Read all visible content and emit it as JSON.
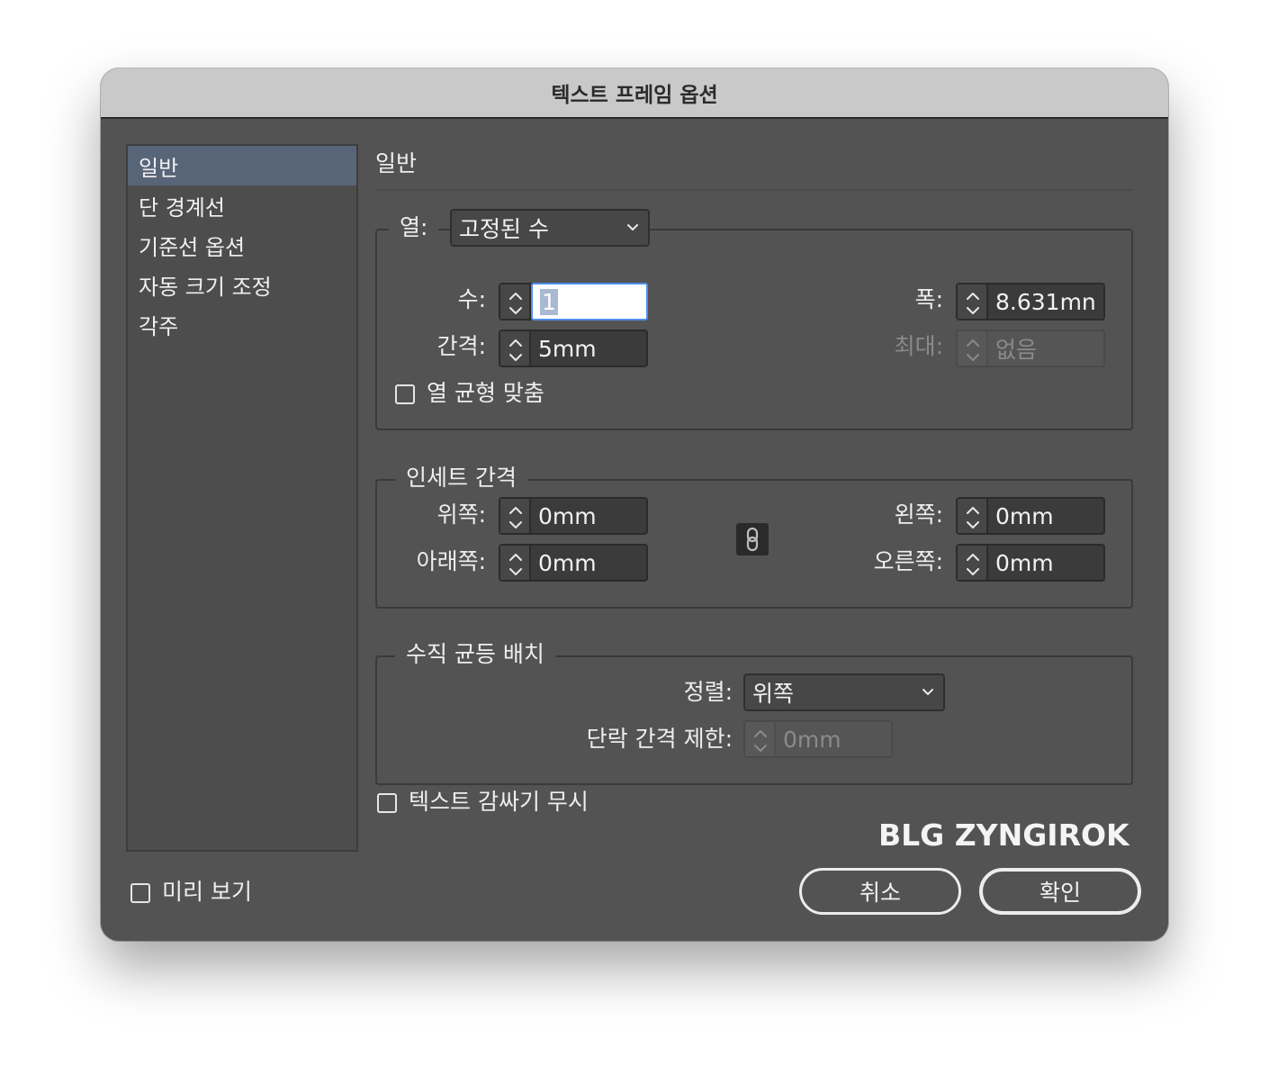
{
  "window": {
    "title": "텍스트 프레임 옵션"
  },
  "sidebar": {
    "items": [
      {
        "label": "일반",
        "selected": true
      },
      {
        "label": "단 경계선"
      },
      {
        "label": "기준선 옵션"
      },
      {
        "label": "자동 크기 조정"
      },
      {
        "label": "각주"
      }
    ]
  },
  "panel": {
    "title": "일반"
  },
  "columns": {
    "legend": "열:",
    "type_value": "고정된 수",
    "number_label": "수:",
    "number_value": "1",
    "gutter_label": "간격:",
    "gutter_value": "5mm",
    "width_label": "폭:",
    "width_value": "8.631mn",
    "max_label": "최대:",
    "max_value": "없음",
    "balance_label": "열 균형 맞춤"
  },
  "inset": {
    "legend": "인세트 간격",
    "top_label": "위쪽:",
    "top_value": "0mm",
    "bottom_label": "아래쪽:",
    "bottom_value": "0mm",
    "left_label": "왼쪽:",
    "left_value": "0mm",
    "right_label": "오른쪽:",
    "right_value": "0mm"
  },
  "vertical": {
    "legend": "수직 균등 배치",
    "align_label": "정렬:",
    "align_value": "위쪽",
    "para_label": "단락 간격 제한:",
    "para_value": "0mm"
  },
  "ignore_wrap_label": "텍스트 감싸기 무시",
  "preview_label": "미리 보기",
  "watermark": "BLG ZYNGIROK",
  "buttons": {
    "cancel": "취소",
    "ok": "확인"
  },
  "colors": {
    "dialog_bg": "#535353",
    "selected": "#586579",
    "focus": "#4d8ff0"
  },
  "icons": [
    "stepper-arrows-icon",
    "chevron-down-icon",
    "chain-link-icon"
  ]
}
